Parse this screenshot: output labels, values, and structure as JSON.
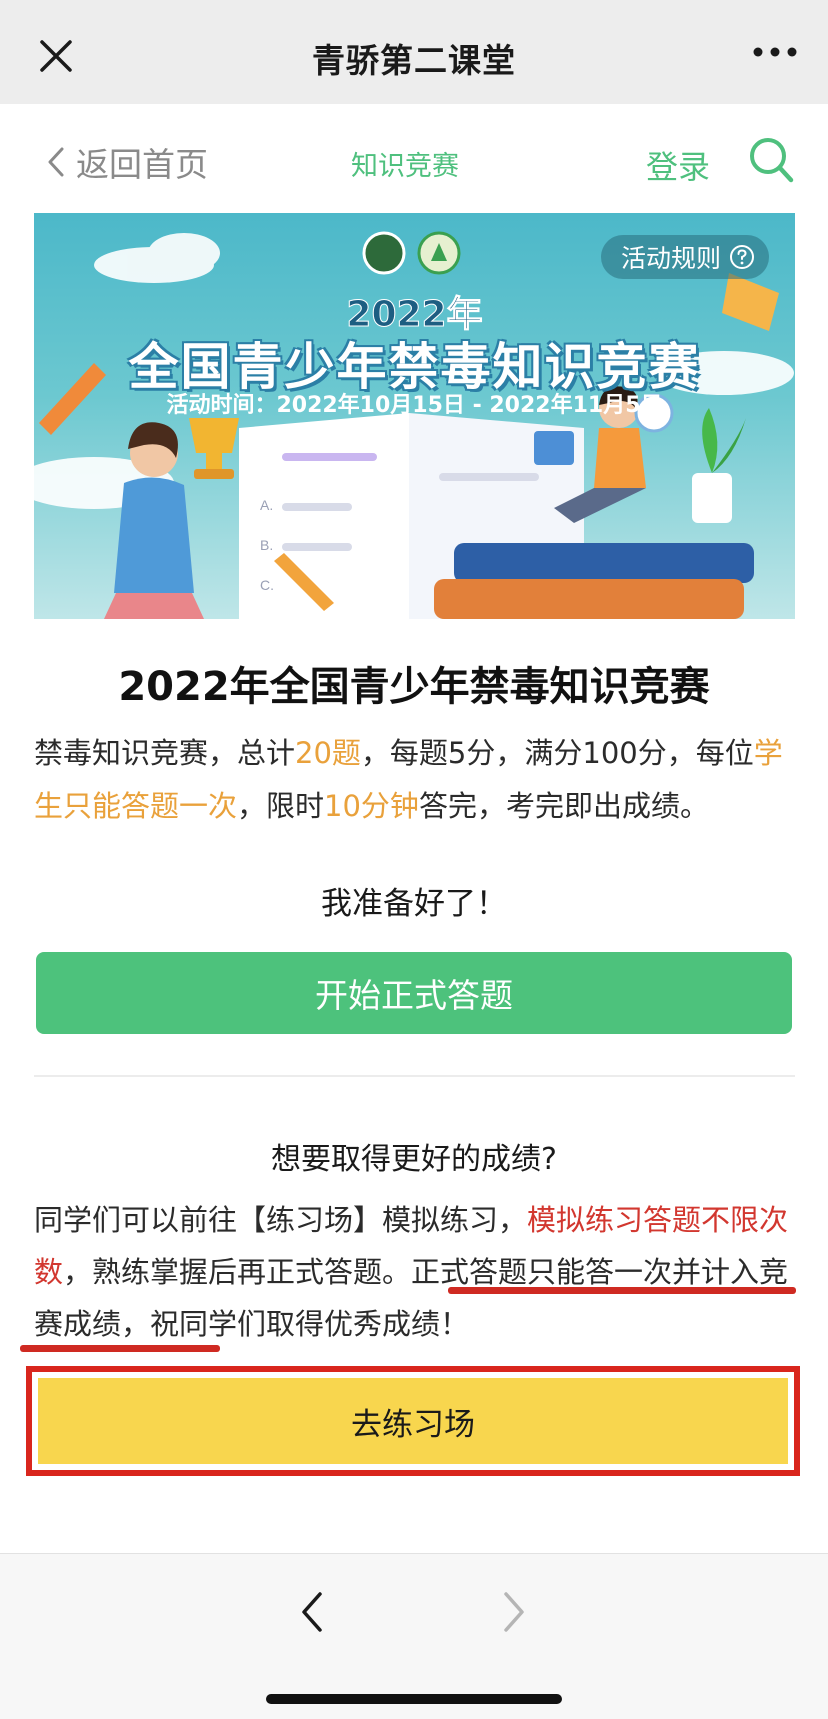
{
  "wechat_bar": {
    "title": "青骄第二课堂",
    "close_icon": "close-icon",
    "more_icon": "more-dots-icon"
  },
  "header": {
    "back_label": "返回首页",
    "center_label": "知识竞赛",
    "login_label": "登录",
    "search_icon": "search-icon",
    "accent_color": "#4fc07e"
  },
  "banner": {
    "rules_label": "活动规则",
    "year": "2022年",
    "title": "全国青少年禁毒知识竞赛",
    "time": "活动时间：2022年10月15日 - 2022年11月5日",
    "option_letters": [
      "A.",
      "B.",
      "C."
    ]
  },
  "content": {
    "title": "2022年全国青少年禁毒知识竞赛",
    "desc": {
      "p1": "禁毒知识竞赛，总计",
      "count": "20题",
      "p2": "，每题5分，满分100分，每位",
      "once": "学生只能答题一次",
      "p3": "，限时",
      "time": "10分钟",
      "p4": "答完，考完即出成绩。"
    },
    "ready": "我准备好了！",
    "start_button": "开始正式答题",
    "better": "想要取得更好的成绩?",
    "desc2": {
      "p1": "同学们可以前往【练习场】模拟练习，",
      "unlimited": "模拟练习答题不限次数",
      "p2": "，熟练掌握后再正式答题。",
      "formal": "正式答题只能答一次并计入竞赛成绩",
      "p3": "，祝同学们取得优秀成绩！"
    },
    "practice_button": "去练习场",
    "colors": {
      "green": "#4dc27c",
      "orange": "#e9a13b",
      "red": "#d2372f",
      "yellow": "#f8d64e"
    }
  },
  "bottom_bar": {
    "back_icon": "chevron-left-icon",
    "forward_icon": "chevron-right-icon"
  }
}
